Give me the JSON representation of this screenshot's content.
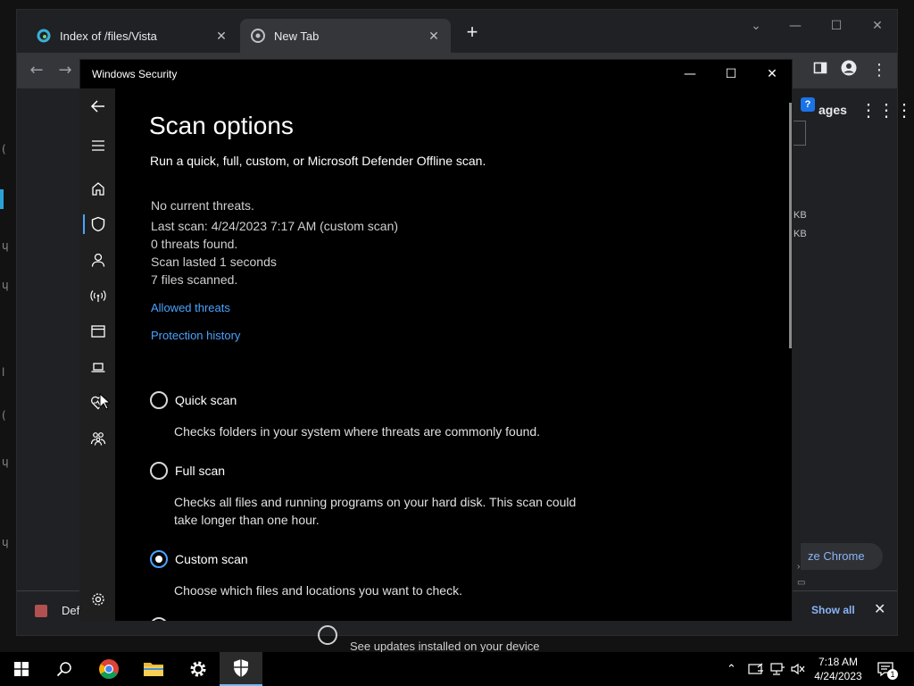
{
  "browser": {
    "tabs": [
      {
        "label": "Index of /files/Vista",
        "active": false
      },
      {
        "label": "New Tab",
        "active": true
      }
    ],
    "peek": {
      "ages": "ages",
      "help": "?",
      "kb1": "KB",
      "kb2": "KB",
      "customize": "ze Chrome"
    },
    "shelf": {
      "file_label": "Def",
      "show_all": "Show all"
    }
  },
  "update_notice": "See updates installed on your device",
  "security": {
    "window_title": "Windows Security",
    "page_title": "Scan options",
    "subtitle": "Run a quick, full, custom, or Microsoft Defender Offline scan.",
    "status": {
      "no_threats": "No current threats.",
      "last_scan": "Last scan: 4/24/2023 7:17 AM (custom scan)",
      "threats_found": "0 threats found.",
      "duration": "Scan lasted 1 seconds",
      "files_scanned": "7 files scanned."
    },
    "links": {
      "allowed": "Allowed threats",
      "history": "Protection history"
    },
    "options": [
      {
        "label": "Quick scan",
        "description": "Checks folders in your system where threats are commonly found.",
        "checked": false
      },
      {
        "label": "Full scan",
        "description": "Checks all files and running programs on your hard disk. This scan could take longer than one hour.",
        "checked": false
      },
      {
        "label": "Custom scan",
        "description": "Choose which files and locations you want to check.",
        "checked": true
      }
    ],
    "nav_icons": [
      "back-icon",
      "menu-icon",
      "home-icon",
      "shield-icon",
      "account-icon",
      "network-icon",
      "app-browser-icon",
      "device-icon",
      "health-icon",
      "family-icon",
      "settings-icon"
    ]
  },
  "taskbar": {
    "time": "7:18 AM",
    "date": "4/24/2023",
    "notification_count": "1"
  },
  "colors": {
    "accent": "#4aa3ff",
    "window_bg": "#000000",
    "nav_bg": "#1f1f1f",
    "chrome_bg": "#202124"
  }
}
